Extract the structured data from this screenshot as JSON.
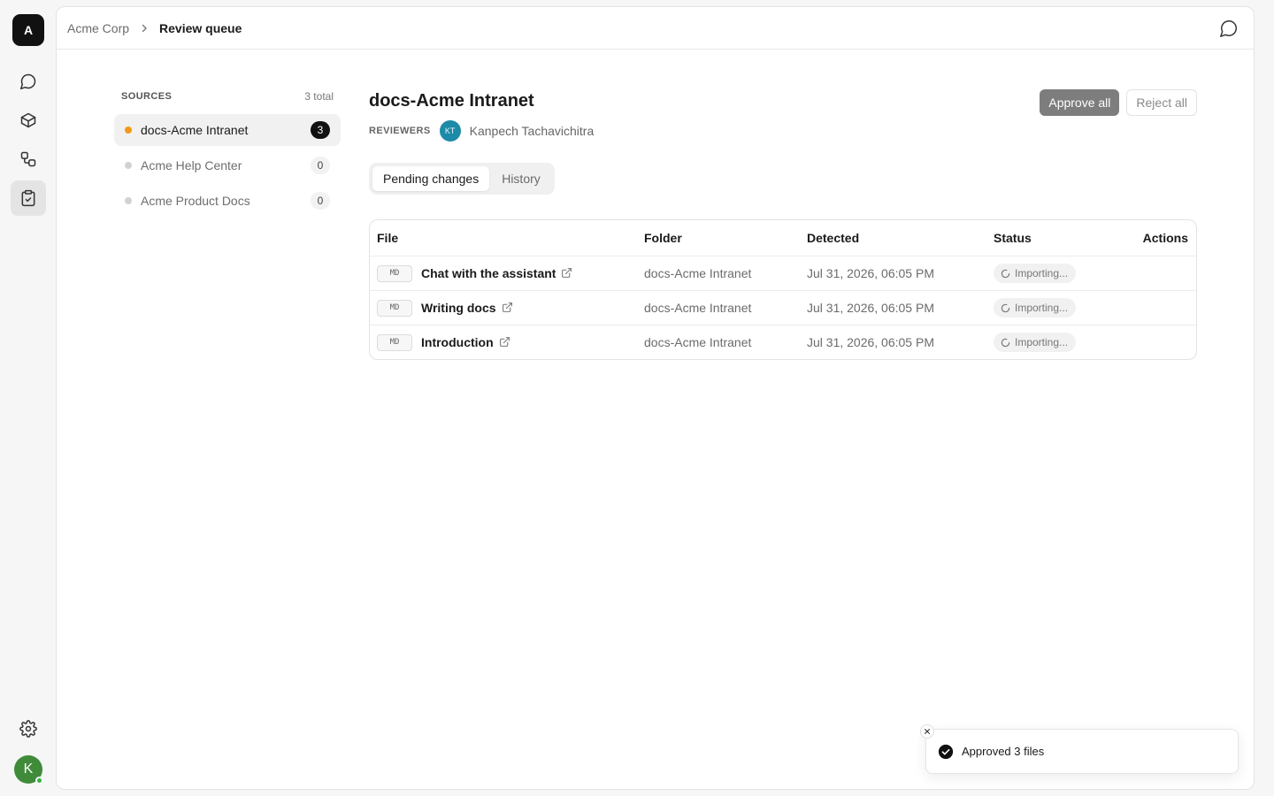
{
  "workspace": {
    "initial": "A"
  },
  "breadcrumb": {
    "org": "Acme Corp",
    "current": "Review queue"
  },
  "rail": {
    "items": [
      "chat-icon",
      "package-icon",
      "workflow-icon",
      "review-icon"
    ],
    "active": "review-icon",
    "bottom": [
      "settings-icon"
    ]
  },
  "user": {
    "initial": "K",
    "online": true,
    "color": "#3f8b3a"
  },
  "sources": {
    "title": "SOURCES",
    "total": "3 total",
    "items": [
      {
        "label": "docs-Acme Intranet",
        "count": "3",
        "active": true
      },
      {
        "label": "Acme Help Center",
        "count": "0",
        "active": false
      },
      {
        "label": "Acme Product Docs",
        "count": "0",
        "active": false
      }
    ]
  },
  "detail": {
    "title": "docs-Acme Intranet",
    "reviewers_label": "REVIEWERS",
    "reviewer": {
      "initials": "KT",
      "name": "Kanpech Tachavichitra",
      "color": "#1d8aa8"
    },
    "approve_label": "Approve all",
    "reject_label": "Reject all",
    "tabs": [
      {
        "label": "Pending changes",
        "active": true
      },
      {
        "label": "History",
        "active": false
      }
    ]
  },
  "table": {
    "columns": [
      "File",
      "Folder",
      "Detected",
      "Status",
      "Actions"
    ],
    "rows": [
      {
        "type": "MD",
        "file": "Chat with the assistant",
        "folder": "docs-Acme Intranet",
        "detected": "Jul 31, 2026, 06:05 PM",
        "status": "Importing..."
      },
      {
        "type": "MD",
        "file": "Writing docs",
        "folder": "docs-Acme Intranet",
        "detected": "Jul 31, 2026, 06:05 PM",
        "status": "Importing..."
      },
      {
        "type": "MD",
        "file": "Introduction",
        "folder": "docs-Acme Intranet",
        "detected": "Jul 31, 2026, 06:05 PM",
        "status": "Importing..."
      }
    ]
  },
  "toast": {
    "message": "Approved 3 files",
    "icon": "check-circle-icon"
  },
  "colors": {
    "accent_dot": "#f29a18",
    "approve_button": "#7d7d7d"
  }
}
